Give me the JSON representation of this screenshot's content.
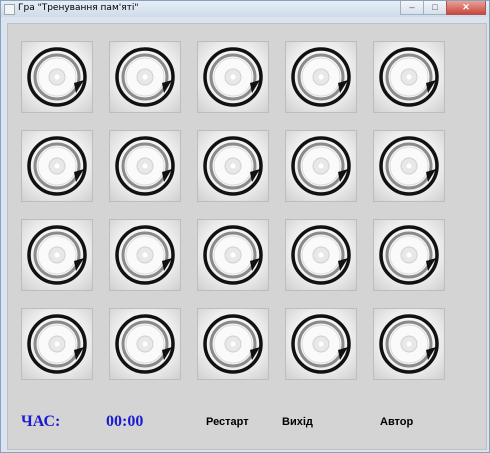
{
  "window": {
    "title": "Гра \"Тренування пам'яті\""
  },
  "footer": {
    "time_label": "ЧАС:",
    "time_value": "00:00",
    "restart_label": "Рестарт",
    "exit_label": "Вихід",
    "author_label": "Автор"
  },
  "board": {
    "rows": 4,
    "cols": 5,
    "card_back_icon": "rotate-disc-icon"
  },
  "colors": {
    "timer": "#1b1bd1",
    "background": "#d4d4d4"
  }
}
